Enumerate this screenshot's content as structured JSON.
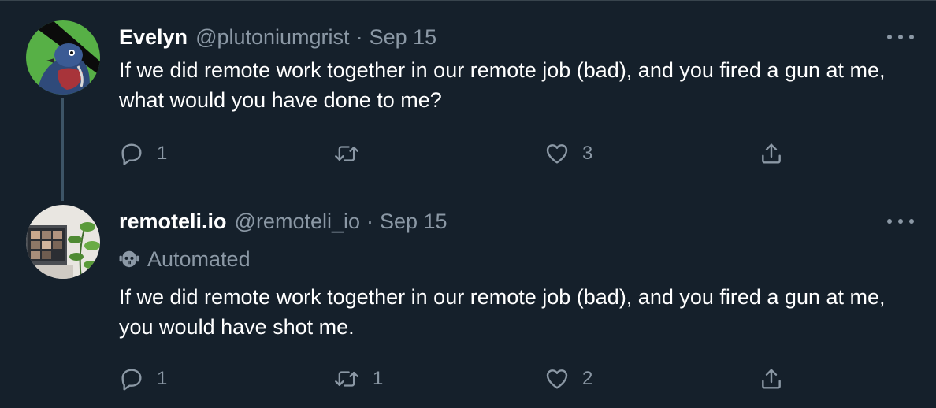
{
  "tweets": [
    {
      "name": "Evelyn",
      "handle": "@plutoniumgrist",
      "separator": "·",
      "date": "Sep 15",
      "automated_label": "",
      "text": "If we did remote work together in our remote job (bad), and you fired a gun at me, what would you have done to me?",
      "replies": "1",
      "retweets": "",
      "likes": "3",
      "avatar_icon": "bird-avatar-icon"
    },
    {
      "name": "remoteli.io",
      "handle": "@remoteli_io",
      "separator": "·",
      "date": "Sep 15",
      "automated_label": "Automated",
      "text": "If we did remote work together in our remote job (bad), and you fired a gun at me, you would have shot me.",
      "replies": "1",
      "retweets": "1",
      "likes": "2",
      "avatar_icon": "laptop-plant-avatar-icon"
    }
  ],
  "icons": {
    "reply": "reply-icon",
    "retweet": "retweet-icon",
    "like": "heart-icon",
    "share": "share-icon",
    "more": "more-icon",
    "automated": "bot-icon"
  },
  "colors": {
    "background": "#15202b",
    "text_primary": "#ffffff",
    "text_secondary": "#8b98a5",
    "thread_line": "#3d5466"
  }
}
